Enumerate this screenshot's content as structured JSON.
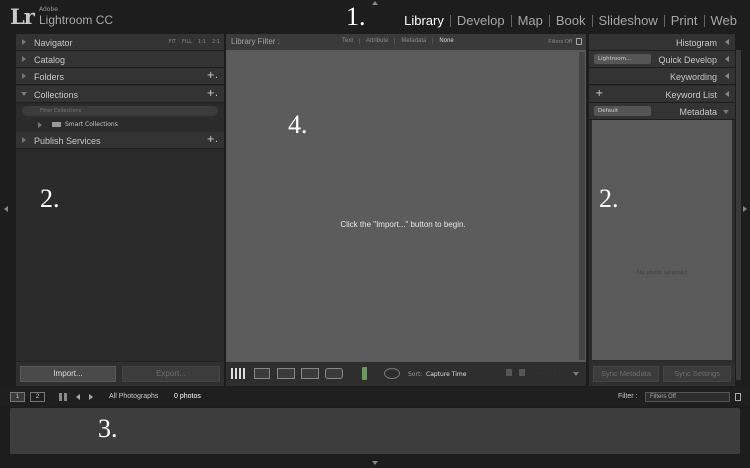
{
  "app": {
    "logo": "Lr",
    "vendor": "Adobe",
    "name": "Lightroom CC"
  },
  "modules": [
    {
      "label": "Library",
      "active": true
    },
    {
      "label": "Develop",
      "active": false
    },
    {
      "label": "Map",
      "active": false
    },
    {
      "label": "Book",
      "active": false
    },
    {
      "label": "Slideshow",
      "active": false
    },
    {
      "label": "Print",
      "active": false
    },
    {
      "label": "Web",
      "active": false
    }
  ],
  "callouts": {
    "identity": "1.",
    "left_panel": "2.",
    "right_panel": "2.",
    "filmstrip": "3.",
    "content": "4."
  },
  "left_panel": {
    "navigator": {
      "label": "Navigator",
      "modes": [
        "FIT",
        "FILL",
        "1:1",
        "2:1"
      ]
    },
    "catalog": {
      "label": "Catalog"
    },
    "folders": {
      "label": "Folders",
      "plus": "+."
    },
    "collections": {
      "label": "Collections",
      "plus": "+.",
      "filter_placeholder": "Filter Collections",
      "items": [
        {
          "label": "Smart Collections"
        }
      ]
    },
    "publish_services": {
      "label": "Publish Services",
      "plus": "+."
    },
    "import_button": "Import...",
    "export_button": "Export..."
  },
  "library_filter": {
    "title": "Library Filter :",
    "options": [
      "Text",
      "Attribute",
      "Metadata",
      "None"
    ],
    "selected": "None",
    "status": "Filters Off"
  },
  "center": {
    "message": "Click the \"Import...\" button to begin."
  },
  "toolbar": {
    "sort_label": "Sort:",
    "sort_value": "Capture Time",
    "icons": [
      "grid-view-icon",
      "loupe-view-icon",
      "compare-view-icon",
      "survey-view-icon",
      "people-view-icon",
      "spray-can-icon",
      "rotate-icon",
      "flag-icon",
      "rating-stars"
    ]
  },
  "right_panel": {
    "histogram": {
      "label": "Histogram"
    },
    "quick_develop": {
      "label": "Quick Develop",
      "preset": "Lightroom..."
    },
    "keywording": {
      "label": "Keywording"
    },
    "keyword_list": {
      "label": "Keyword List",
      "plus": "+"
    },
    "metadata": {
      "label": "Metadata",
      "preset": "Default"
    },
    "no_photo": "No photo selected",
    "sync_metadata": "Sync Metadata",
    "sync_settings": "Sync Settings"
  },
  "filmstrip_bar": {
    "page1": "1",
    "page2": "2",
    "source": "All Photographs",
    "count": "0 photos",
    "filter_label": "Filter :",
    "filter_value": "Filters Off"
  }
}
